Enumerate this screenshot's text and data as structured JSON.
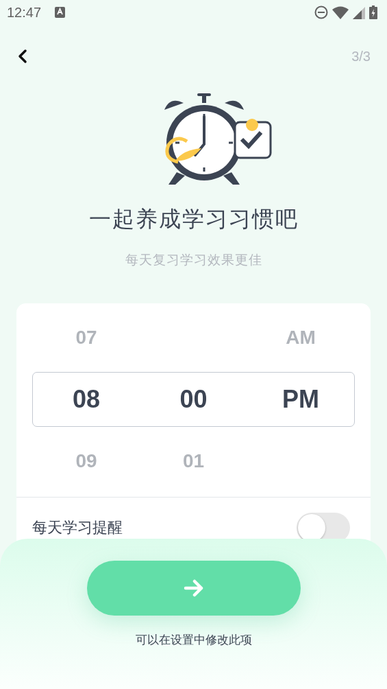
{
  "status_bar": {
    "time": "12:47"
  },
  "header": {
    "step": "3/3"
  },
  "title": "一起养成学习习惯吧",
  "subtitle": "每天复习学习效果更佳",
  "picker": {
    "columns": [
      {
        "above": "07",
        "current": "08",
        "below": "09"
      },
      {
        "current": "00",
        "below": "01"
      },
      {
        "above": "AM",
        "current": "PM"
      }
    ]
  },
  "reminder": {
    "label": "每天学习提醒",
    "on": false
  },
  "footer": {
    "note": "可以在设置中修改此项"
  }
}
